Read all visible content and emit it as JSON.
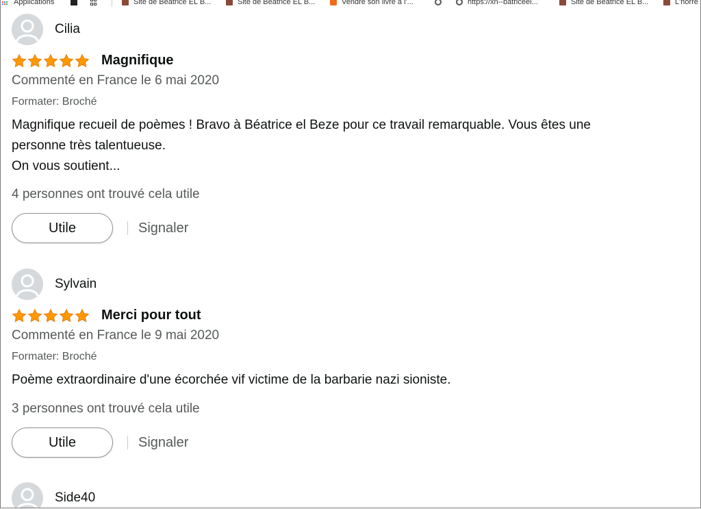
{
  "bookmarks": [
    {
      "label": "Applications",
      "icon": "apps-grid-icon"
    },
    {
      "label": "",
      "icon": "square-icon"
    },
    {
      "label": "",
      "icon": "grid-icon"
    },
    {
      "label": "Site de Beatrice EL B...",
      "icon": "photo-favicon"
    },
    {
      "label": "Site de Beatrice EL B...",
      "icon": "photo-favicon"
    },
    {
      "label": "Vendre son livre à l'...",
      "icon": "orange-favicon"
    },
    {
      "label": "",
      "icon": "globe-icon"
    },
    {
      "label": "https://xn--batriceel...",
      "icon": "globe-icon"
    },
    {
      "label": "Site de Beatrice EL B...",
      "icon": "photo-favicon"
    },
    {
      "label": "L'horre",
      "icon": "photo-favicon"
    }
  ],
  "colors": {
    "star": "#ff9900",
    "star_outline": "#e47911",
    "muted_text": "#565959",
    "text": "#0f1111",
    "avatar_bg": "#d6d9dc"
  },
  "reviews": [
    {
      "author": "Cilia",
      "rating": 5,
      "title": "Magnifique",
      "date": "Commenté en France le 6 mai 2020",
      "format": "Formater: Broché",
      "body": [
        "Magnifique recueil de poèmes ! Bravo à Béatrice el Beze pour ce travail remarquable. Vous êtes une",
        "personne très talentueuse.",
        "On vous soutient..."
      ],
      "helpful": "4 personnes ont trouvé cela utile",
      "helpful_button": "Utile",
      "report": "Signaler"
    },
    {
      "author": "Sylvain",
      "rating": 5,
      "title": "Merci pour tout",
      "date": "Commenté en France le 9 mai 2020",
      "format": "Formater: Broché",
      "body": [
        "Poème extraordinaire d'une écorchée vif victime de la barbarie nazi sioniste."
      ],
      "helpful": "3 personnes ont trouvé cela utile",
      "helpful_button": "Utile",
      "report": "Signaler"
    },
    {
      "author": "Side40"
    }
  ]
}
